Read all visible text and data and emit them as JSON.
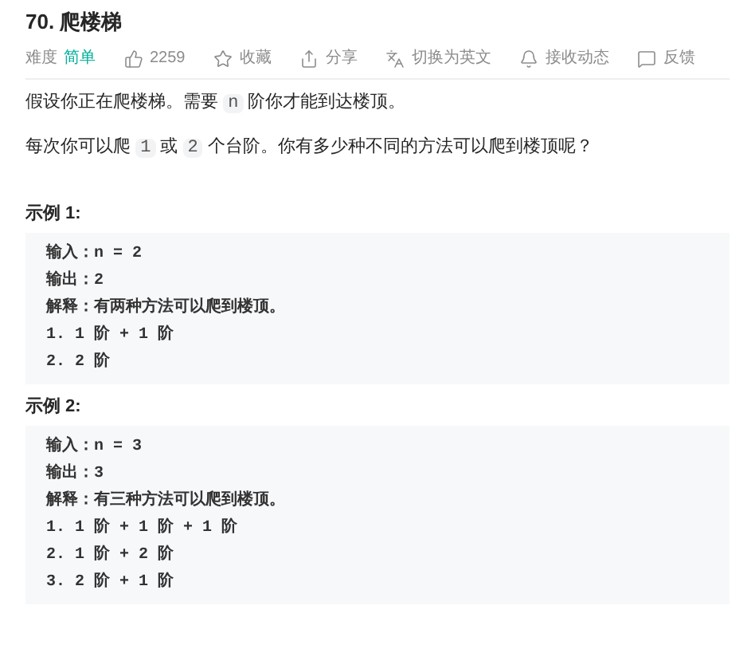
{
  "title": "70. 爬楼梯",
  "meta": [
    {
      "kind": "difficulty",
      "label": "难度",
      "value": "简单"
    },
    {
      "kind": "like",
      "label": "2259"
    },
    {
      "kind": "star",
      "label": "收藏"
    },
    {
      "kind": "share",
      "label": "分享"
    },
    {
      "kind": "translate",
      "label": "切换为英文"
    },
    {
      "kind": "bell",
      "label": "接收动态"
    },
    {
      "kind": "feedback",
      "label": "反馈"
    }
  ],
  "description": [
    [
      {
        "kind": "text",
        "text": "假设你正在爬楼梯。需要 "
      },
      {
        "kind": "code",
        "text": "n"
      },
      {
        "kind": "text",
        "text": " 阶你才能到达楼顶。"
      }
    ],
    [
      {
        "kind": "text",
        "text": "每次你可以爬 "
      },
      {
        "kind": "code",
        "text": "1"
      },
      {
        "kind": "text",
        "text": " 或 "
      },
      {
        "kind": "code",
        "text": "2"
      },
      {
        "kind": "text",
        "text": " 个台阶。你有多少种不同的方法可以爬到楼顶呢？"
      }
    ]
  ],
  "examples": [
    {
      "heading": "示例 1:",
      "lines": [
        "输入：n = 2",
        "输出：2",
        "解释：有两种方法可以爬到楼顶。",
        "1. 1 阶 + 1 阶",
        "2. 2 阶"
      ]
    },
    {
      "heading": "示例 2:",
      "lines": [
        "输入：n = 3",
        "输出：3",
        "解释：有三种方法可以爬到楼顶。",
        "1. 1 阶 + 1 阶 + 1 阶",
        "2. 1 阶 + 2 阶",
        "3. 2 阶 + 1 阶"
      ]
    }
  ]
}
